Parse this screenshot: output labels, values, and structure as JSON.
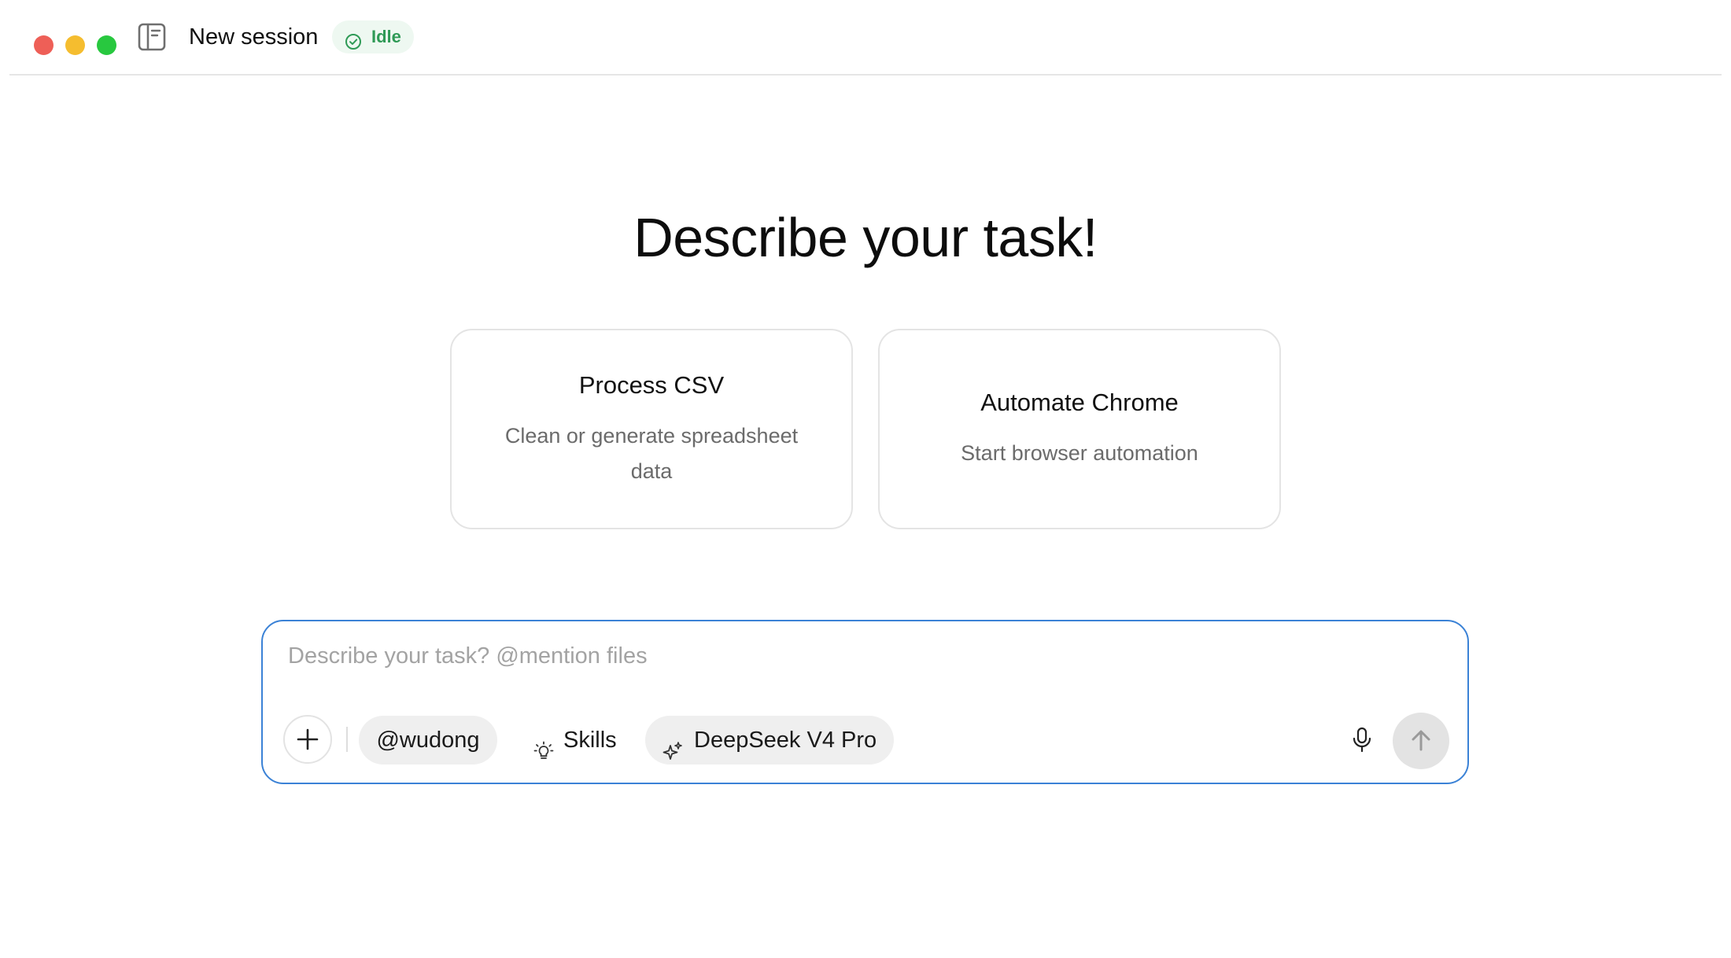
{
  "titlebar": {
    "title": "New session",
    "status": "Idle",
    "status_color": "#2f9a56",
    "icons": {
      "sidebar_toggle": "sidebar-toggle-icon",
      "status": "check-circle-icon"
    }
  },
  "main": {
    "heading": "Describe your task!",
    "cards": [
      {
        "title": "Process CSV",
        "description": "Clean or generate spreadsheet data"
      },
      {
        "title": "Automate Chrome",
        "description": "Start browser automation"
      }
    ]
  },
  "composer": {
    "placeholder": "Describe your task? @mention files",
    "value": "",
    "accent_color": "#3b82d6",
    "mention_label": "@wudong",
    "skills_label": "Skills",
    "model_label": "DeepSeek V4 Pro",
    "icons": {
      "add": "plus-icon",
      "skills": "lightbulb-icon",
      "model": "sparkles-icon",
      "mic": "microphone-icon",
      "send": "arrow-up-icon"
    }
  }
}
